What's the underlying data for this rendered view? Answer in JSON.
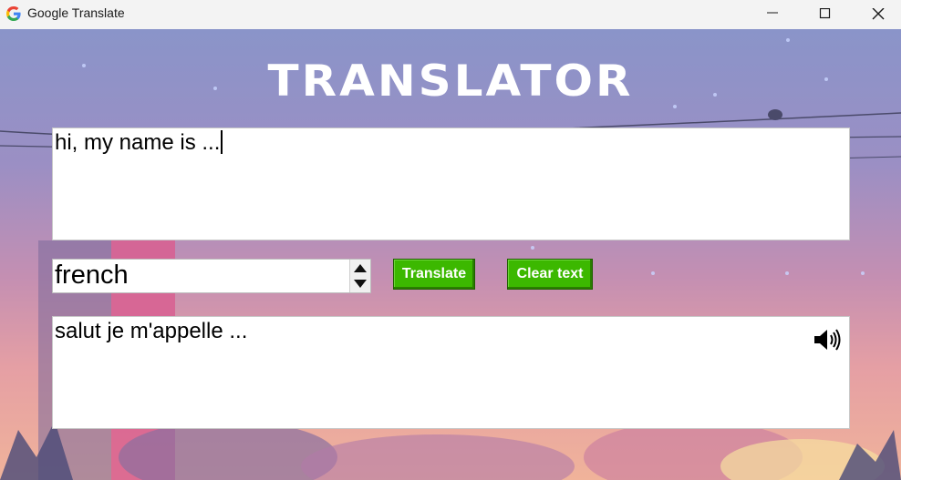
{
  "window": {
    "title": "Google Translate",
    "controls": [
      "minimize",
      "maximize",
      "close"
    ]
  },
  "app": {
    "heading": "TRANSLATOR",
    "input_text": "hi, my name is ...",
    "target_language": "french",
    "translate_label": "Translate",
    "clear_label": "Clear text",
    "output_text": "salut je m'appelle ..."
  },
  "icons": {
    "logo": "google-g-icon",
    "speaker": "speaker-icon",
    "spin_up": "triangle-up-icon",
    "spin_down": "triangle-down-icon"
  },
  "colors": {
    "button_green": "#3cb800",
    "background_top": "#8a94c9",
    "background_bottom": "#f0b39a"
  }
}
